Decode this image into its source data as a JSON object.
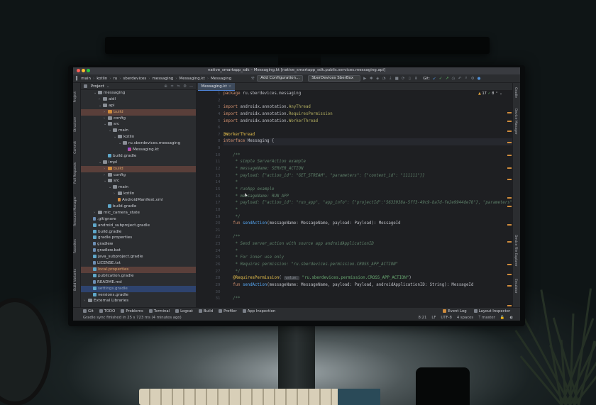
{
  "window": {
    "title": "native_smartapp_sdk – Messaging.kt [native_smartapp_sdk.public.services.messaging.api]"
  },
  "breadcrumb": [
    "main",
    "kotlin",
    "ru",
    "sberdevices",
    "messaging",
    "Messaging.kt",
    "Messaging"
  ],
  "toolbar": {
    "add_config": "Add Configuration...",
    "device": "SberDevices SberBox",
    "git_label": "Git:"
  },
  "left_strip": [
    "Project",
    "Structure",
    "Commit",
    "Pull Requests",
    "Resource Manager",
    "Favorites",
    "Build Variants"
  ],
  "right_strip": [
    "Gradle",
    "Device Manager",
    "Device File Explorer",
    "Emulator"
  ],
  "project": {
    "header": "Project",
    "tree": [
      {
        "label": "messaging",
        "indent": 2,
        "kind": "folder",
        "open": true
      },
      {
        "label": "aidl",
        "indent": 3,
        "kind": "folder",
        "open": false
      },
      {
        "label": "api",
        "indent": 3,
        "kind": "folder",
        "open": true
      },
      {
        "label": "build",
        "indent": 4,
        "kind": "ofolder",
        "open": false,
        "style": "excl"
      },
      {
        "label": "config",
        "indent": 4,
        "kind": "folder",
        "open": false
      },
      {
        "label": "src",
        "indent": 4,
        "kind": "folder",
        "open": true
      },
      {
        "label": "main",
        "indent": 5,
        "kind": "folder",
        "open": true
      },
      {
        "label": "kotlin",
        "indent": 6,
        "kind": "folder",
        "open": true
      },
      {
        "label": "ru.sberdevices.messaging",
        "indent": 7,
        "kind": "folder",
        "open": true
      },
      {
        "label": "Messaging.kt",
        "indent": 8,
        "kind": "kt",
        "open": null
      },
      {
        "label": "build.gradle",
        "indent": 4,
        "kind": "gr",
        "open": null
      },
      {
        "label": "impl",
        "indent": 3,
        "kind": "folder",
        "open": true
      },
      {
        "label": "build",
        "indent": 4,
        "kind": "ofolder",
        "open": false,
        "style": "excl"
      },
      {
        "label": "config",
        "indent": 4,
        "kind": "folder",
        "open": false
      },
      {
        "label": "src",
        "indent": 4,
        "kind": "folder",
        "open": true
      },
      {
        "label": "main",
        "indent": 5,
        "kind": "folder",
        "open": true
      },
      {
        "label": "kotlin",
        "indent": 6,
        "kind": "folder",
        "open": false
      },
      {
        "label": "AndroidManifest.xml",
        "indent": 6,
        "kind": "xml",
        "open": null
      },
      {
        "label": "build.gradle",
        "indent": 4,
        "kind": "gr",
        "open": null
      },
      {
        "label": "mic_camera_state",
        "indent": 2,
        "kind": "folder",
        "open": false
      },
      {
        "label": ".gitignore",
        "indent": 1,
        "kind": "file",
        "open": null
      },
      {
        "label": "android_subproject.gradle",
        "indent": 1,
        "kind": "gr",
        "open": null
      },
      {
        "label": "build.gradle",
        "indent": 1,
        "kind": "gr",
        "open": null
      },
      {
        "label": "gradle.properties",
        "indent": 1,
        "kind": "gr",
        "open": null
      },
      {
        "label": "gradlew",
        "indent": 1,
        "kind": "file",
        "open": null
      },
      {
        "label": "gradlew.bat",
        "indent": 1,
        "kind": "file",
        "open": null
      },
      {
        "label": "java_subproject.gradle",
        "indent": 1,
        "kind": "gr",
        "open": null
      },
      {
        "label": "LICENSE.txt",
        "indent": 1,
        "kind": "file",
        "open": null
      },
      {
        "label": "local.properties",
        "indent": 1,
        "kind": "gr",
        "open": null,
        "style": "excl"
      },
      {
        "label": "publication.gradle",
        "indent": 1,
        "kind": "gr",
        "open": null
      },
      {
        "label": "README.md",
        "indent": 1,
        "kind": "file",
        "open": null
      },
      {
        "label": "settings.gradle",
        "indent": 1,
        "kind": "gr",
        "open": null,
        "style": "dim"
      },
      {
        "label": "versions.gradle",
        "indent": 1,
        "kind": "gr",
        "open": null
      },
      {
        "label": "External Libraries",
        "indent": 0,
        "kind": "folder",
        "open": false
      }
    ]
  },
  "editor": {
    "tab": "Messaging.kt",
    "inspect": {
      "warnings": "17",
      "ok": "8"
    },
    "lines": [
      [
        [
          "k",
          "package "
        ],
        [
          "t",
          "ru.sberdevices.messaging"
        ]
      ],
      [],
      [
        [
          "k",
          "import "
        ],
        [
          "t",
          "androidx.annotation."
        ],
        [
          "a",
          "AnyThread"
        ]
      ],
      [
        [
          "k",
          "import "
        ],
        [
          "t",
          "androidx.annotation."
        ],
        [
          "a",
          "RequiresPermission"
        ]
      ],
      [
        [
          "k",
          "import "
        ],
        [
          "t",
          "androidx.annotation."
        ],
        [
          "a",
          "WorkerThread"
        ]
      ],
      [],
      [
        [
          "ann",
          "@WorkerThread"
        ]
      ],
      [
        [
          "k",
          "interface "
        ],
        [
          "t",
          "Messaging {"
        ]
      ],
      [],
      [
        [
          "d",
          "    /**"
        ]
      ],
      [
        [
          "d",
          "     * simple ServerAction example"
        ]
      ],
      [
        [
          "d",
          "     * messageName: SERVER_ACTION"
        ]
      ],
      [
        [
          "d",
          "     * payload: {\"action_id\": \"GET_STREAM\", \"parameters\": {\"content_id\": \"111111\"}}"
        ]
      ],
      [
        [
          "d",
          "     *"
        ]
      ],
      [
        [
          "d",
          "     * runApp example"
        ]
      ],
      [
        [
          "d",
          "     * messageName: RUN_APP"
        ]
      ],
      [
        [
          "d",
          "     * payload: {\"action_id\": \"run_app\", \"app_info\": {\"projectId\":\"5633938a-5ff3-49c9-ba7d-fe2e9944de78\"}, \"parameters\""
        ]
      ],
      [
        [
          "d",
          "     *"
        ]
      ],
      [
        [
          "d",
          "     */"
        ]
      ],
      [
        [
          "k",
          "    fun "
        ],
        [
          "fn",
          "sendAction"
        ],
        [
          "t",
          "(messageName: MessageName, payload: Payload): MessageId"
        ]
      ],
      [],
      [
        [
          "d",
          "    /**"
        ]
      ],
      [
        [
          "d",
          "     * Send server_action with source app androidApplicationID"
        ]
      ],
      [
        [
          "d",
          "     *"
        ]
      ],
      [
        [
          "d",
          "     * For inner use only"
        ]
      ],
      [
        [
          "d",
          "     * Requires permission: \"ru.sberdevices.permission.CROSS_APP_ACTION\""
        ]
      ],
      [
        [
          "d",
          "     */"
        ]
      ],
      [
        [
          "ann",
          "    @RequiresPermission"
        ],
        [
          "t",
          "( "
        ],
        [
          "hint",
          "value:"
        ],
        [
          "s",
          " \"ru.sberdevices.permission.CROSS_APP_ACTION\""
        ],
        [
          "t",
          ")"
        ]
      ],
      [
        [
          "k",
          "    fun "
        ],
        [
          "fn",
          "sendAction"
        ],
        [
          "t",
          "(messageName: MessageName, payload: Payload, androidApplicationID: String): MessageId"
        ]
      ],
      [],
      [
        [
          "d",
          "    /**"
        ]
      ]
    ],
    "current_line": 8
  },
  "toolwindows": [
    "Git",
    "TODO",
    "Problems",
    "Terminal",
    "Logcat",
    "Build",
    "Profiler",
    "App Inspection"
  ],
  "toolwindows_right": [
    "Event Log",
    "Layout Inspector"
  ],
  "status": {
    "message": "Gradle sync finished in 25 s 723 ms (4 minutes ago)",
    "position": "8:21",
    "line_sep": "LF",
    "encoding": "UTF-8",
    "indent": "4 spaces",
    "branch": "master"
  },
  "colors": {
    "accent": "#4e83d6",
    "keyword": "#cf8e6d",
    "string": "#6aab73",
    "doc": "#5f826b",
    "annotation": "#e8c14c"
  }
}
